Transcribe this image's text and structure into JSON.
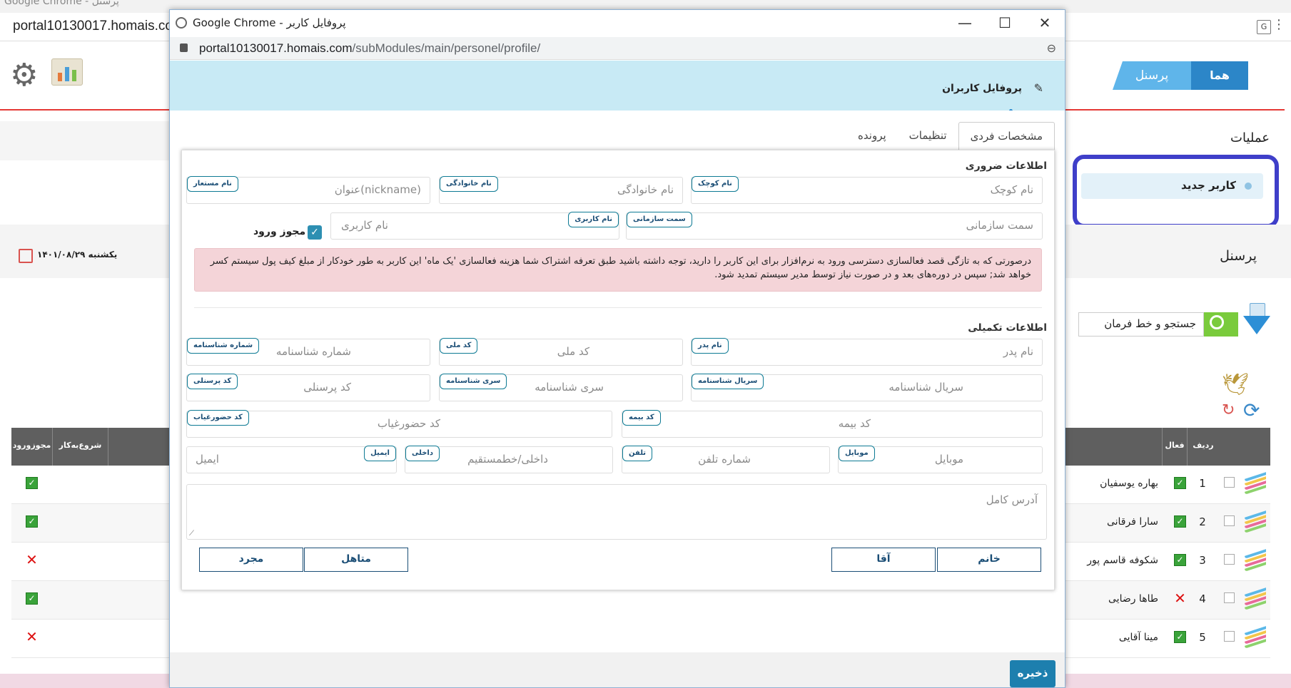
{
  "background": {
    "top_title": "Google Chrome - پرسنل",
    "url": "portal10130017.homais.com",
    "nav_tabs": {
      "hama": "هما",
      "personel": "پرسنل"
    },
    "operations_title": "عملیات",
    "new_user_label": "کاربر جدید",
    "date": "یکشنبه ۱۴۰۱/۰۸/۲۹",
    "section_personel": "پرسنل",
    "search_command_label": "جستجو و خط فرمان",
    "left_table": {
      "headers": [
        "مجوزورود",
        "شروع‌به‌کار"
      ],
      "rows": [
        {
          "mark": "ok"
        },
        {
          "mark": "ok"
        },
        {
          "mark": "x"
        },
        {
          "mark": "ok"
        },
        {
          "mark": "x"
        }
      ]
    },
    "right_table": {
      "headers": [
        "ردیف",
        "فعال"
      ],
      "rows": [
        {
          "num": "1",
          "active": "ok",
          "name": "بهاره یوسفیان"
        },
        {
          "num": "2",
          "active": "ok",
          "name": "سارا فرقانی"
        },
        {
          "num": "3",
          "active": "ok",
          "name": "شکوفه قاسم پور"
        },
        {
          "num": "4",
          "active": "x",
          "name": "طاها رضایی"
        },
        {
          "num": "5",
          "active": "ok",
          "name": "مینا آقایی"
        }
      ]
    }
  },
  "popup": {
    "window_title": "Google Chrome - پروفایل کاربر",
    "url_host": "portal10130017.homais.com",
    "url_path": "/subModules/main/personel/profile/",
    "header_title": "پروفایل کاربران",
    "tabs": [
      "مشخصات فردی",
      "تنظیمات",
      "پرونده"
    ],
    "required_section": "اطلاعات ضروری",
    "supplementary_section": "اطلاعات تکمیلی",
    "fields": {
      "first_name": {
        "placeholder": "نام کوچک",
        "tag": "نام کوچک"
      },
      "last_name": {
        "placeholder": "نام خانوادگی",
        "tag": "نام خانوادگی"
      },
      "nickname": {
        "placeholder": "عنوان(nickname)",
        "tag": "نام مستعار"
      },
      "org_role": {
        "placeholder": "سمت سازمانی",
        "tag": "سمت سازمانی"
      },
      "username": {
        "placeholder": "نام کاربری",
        "tag": "نام کاربری"
      },
      "father_name": {
        "placeholder": "نام پدر",
        "tag": "نام پدر"
      },
      "national_code": {
        "placeholder": "کد ملی",
        "tag": "کد ملی"
      },
      "id_number": {
        "placeholder": "شماره شناسنامه",
        "tag": "شماره شناسنامه"
      },
      "id_serial": {
        "placeholder": "سریال شناسنامه",
        "tag": "سریال شناسنامه"
      },
      "id_series": {
        "placeholder": "سری شناسنامه",
        "tag": "سری شناسنامه"
      },
      "personnel_code": {
        "placeholder": "کد پرسنلی",
        "tag": "کد پرسنلی"
      },
      "insurance_code": {
        "placeholder": "کد بیمه",
        "tag": "کد بیمه"
      },
      "attendance_code": {
        "placeholder": "کد حضورغیاب",
        "tag": "کد حضورغیاب"
      },
      "mobile": {
        "placeholder": "موبایل",
        "tag": "موبایل"
      },
      "phone": {
        "placeholder": "شماره تلفن",
        "tag": "تلفن"
      },
      "extension": {
        "placeholder": "داخلی/خطمستقیم",
        "tag": "داخلی"
      },
      "email": {
        "placeholder": "ایمیل",
        "tag": "ایمیل"
      },
      "address": {
        "placeholder": "آدرس کامل"
      }
    },
    "login_permission_label": "مجوز ورود",
    "alert_text": "درصورتی که به تازگی قصد فعالسازی دسترسی ورود به نرم‌افزار برای این کاربر را دارید، توجه داشته باشید طبق تعرفه اشتراک شما هزینه فعالسازی 'یک ماه' این کاربر به طور خودکار از مبلغ کیف پول سیستم کسر خواهد شد; سپس در دوره‌های بعد و در صورت نیاز توسط مدیر سیستم تمدید شود.",
    "gender_buttons": {
      "female": "خانم",
      "male": "آقا"
    },
    "marital_buttons": {
      "married": "متاهل",
      "single": "مجرد"
    },
    "save_label": "ذخیره"
  },
  "colors": {
    "header_bg": "#c8eaf5",
    "accent": "#1d7fae",
    "alert_bg": "#f4d4d8",
    "highlight_frame": "#3f3fc9"
  }
}
